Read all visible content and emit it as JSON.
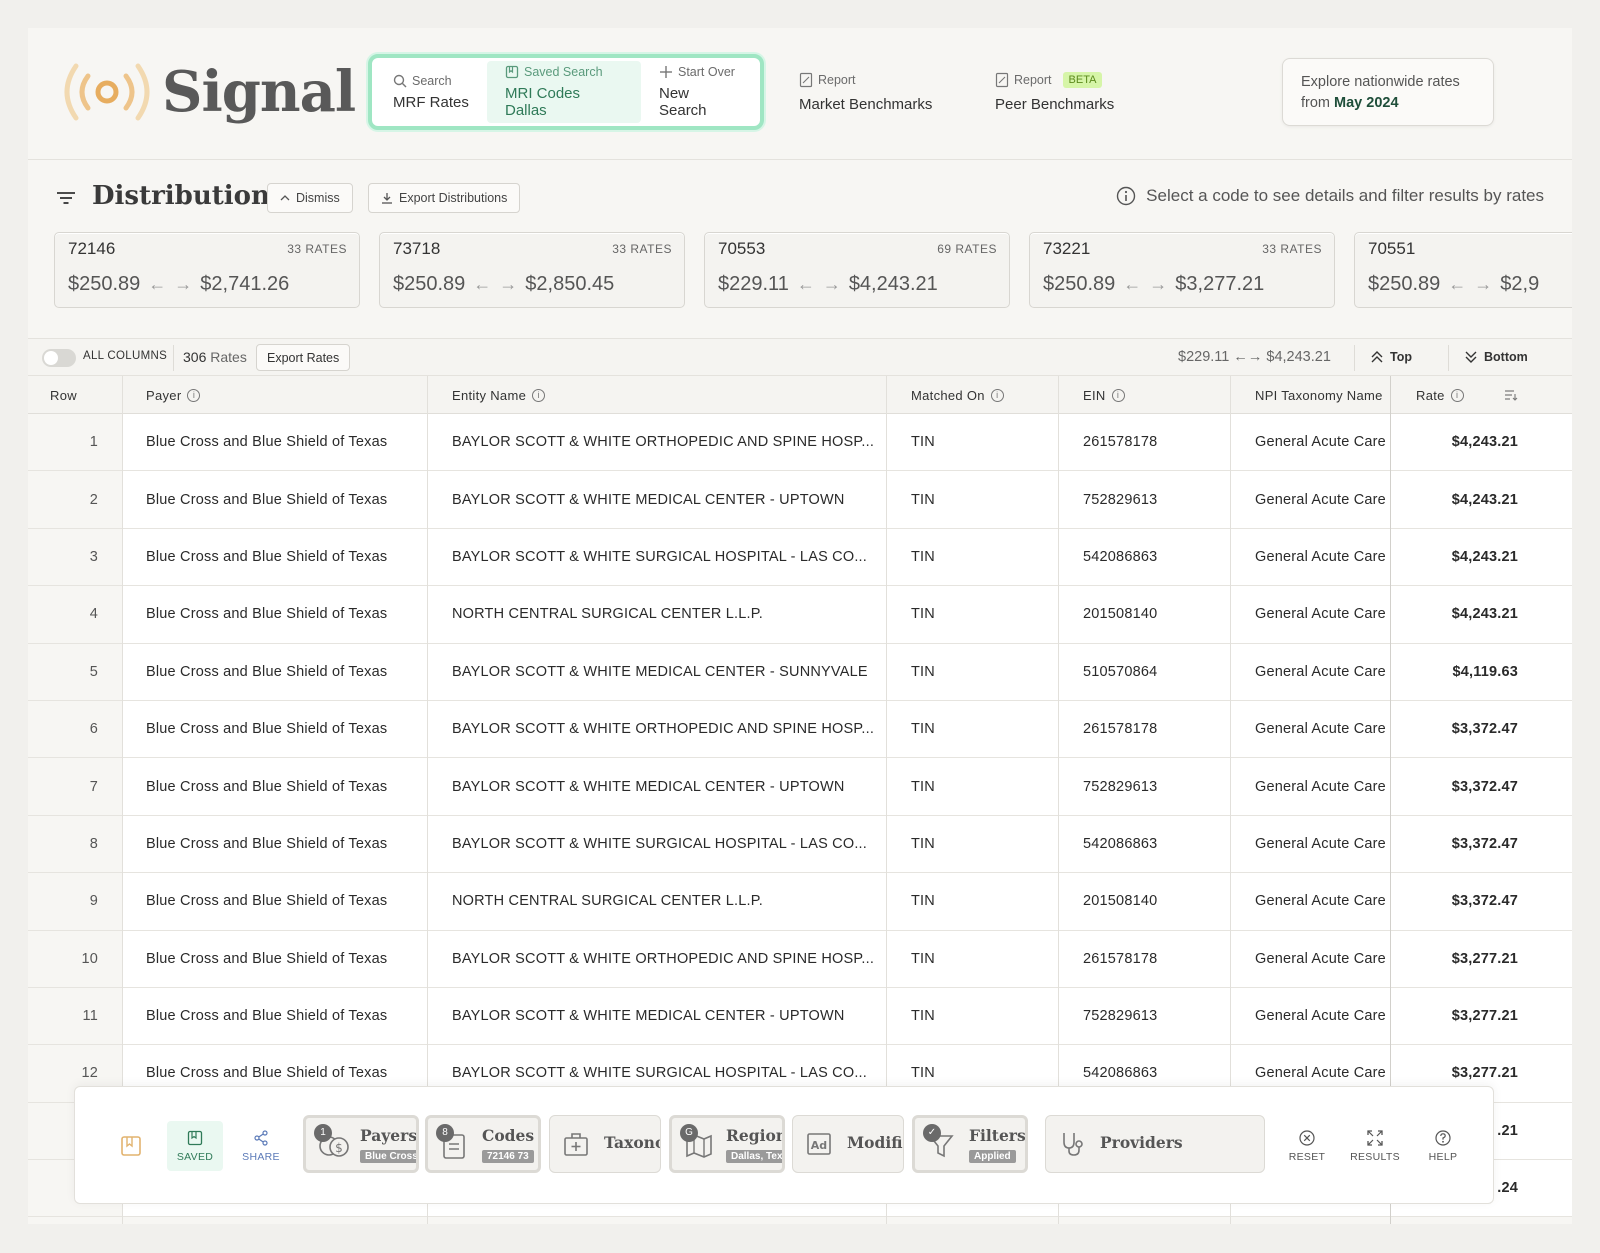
{
  "brand": {
    "name": "Signal"
  },
  "search": {
    "items": [
      {
        "small": "Search",
        "big": "MRF Rates",
        "icon": "search-icon"
      },
      {
        "small": "Saved Search",
        "big": "MRI Codes Dallas",
        "icon": "bookmark-icon"
      },
      {
        "small": "Start Over",
        "big": "New Search",
        "icon": "plus-icon"
      }
    ]
  },
  "reports": [
    {
      "small": "Report",
      "big": "Market Benchmarks"
    },
    {
      "small": "Report",
      "badge": "BETA",
      "big": "Peer Benchmarks"
    }
  ],
  "explore": {
    "line1": "Explore nationwide rates",
    "from": "from",
    "period": "May 2024"
  },
  "distributions": {
    "title": "Distributions",
    "dismiss": "Dismiss",
    "export": "Export Distributions",
    "hint": "Select a code to see details and filter results by rates",
    "cards": [
      {
        "code": "72146",
        "count": "33 RATES",
        "min": "$250.89",
        "max": "$2,741.26"
      },
      {
        "code": "73718",
        "count": "33 RATES",
        "min": "$250.89",
        "max": "$2,850.45"
      },
      {
        "code": "70553",
        "count": "69 RATES",
        "min": "$229.11",
        "max": "$4,243.21"
      },
      {
        "code": "73221",
        "count": "33 RATES",
        "min": "$250.89",
        "max": "$3,277.21"
      },
      {
        "code": "70551",
        "count": "",
        "min": "$250.89",
        "max": "$2,9"
      }
    ]
  },
  "toolbar": {
    "all_columns": "ALL COLUMNS",
    "rates_count": "306",
    "rates_label": "Rates",
    "export_rates": "Export Rates",
    "range": "$229.11 ←→ $4,243.21",
    "top": "Top",
    "bottom": "Bottom"
  },
  "table": {
    "columns": [
      "Row",
      "Payer",
      "Entity Name",
      "Matched On",
      "EIN",
      "NPI Taxonomy Name",
      "Rate"
    ],
    "rows": [
      {
        "row": "1",
        "payer": "Blue Cross and Blue Shield of Texas",
        "entity": "BAYLOR SCOTT & WHITE ORTHOPEDIC AND SPINE HOSP...",
        "matched": "TIN",
        "ein": "261578178",
        "taxonomy": "General Acute Care",
        "rate": "$4,243.21"
      },
      {
        "row": "2",
        "payer": "Blue Cross and Blue Shield of Texas",
        "entity": "BAYLOR SCOTT & WHITE MEDICAL CENTER - UPTOWN",
        "matched": "TIN",
        "ein": "752829613",
        "taxonomy": "General Acute Care",
        "rate": "$4,243.21"
      },
      {
        "row": "3",
        "payer": "Blue Cross and Blue Shield of Texas",
        "entity": "BAYLOR SCOTT & WHITE SURGICAL HOSPITAL - LAS CO...",
        "matched": "TIN",
        "ein": "542086863",
        "taxonomy": "General Acute Care",
        "rate": "$4,243.21"
      },
      {
        "row": "4",
        "payer": "Blue Cross and Blue Shield of Texas",
        "entity": "NORTH CENTRAL SURGICAL CENTER L.L.P.",
        "matched": "TIN",
        "ein": "201508140",
        "taxonomy": "General Acute Care",
        "rate": "$4,243.21"
      },
      {
        "row": "5",
        "payer": "Blue Cross and Blue Shield of Texas",
        "entity": "BAYLOR SCOTT & WHITE MEDICAL CENTER - SUNNYVALE",
        "matched": "TIN",
        "ein": "510570864",
        "taxonomy": "General Acute Care",
        "rate": "$4,119.63"
      },
      {
        "row": "6",
        "payer": "Blue Cross and Blue Shield of Texas",
        "entity": "BAYLOR SCOTT & WHITE ORTHOPEDIC AND SPINE HOSP...",
        "matched": "TIN",
        "ein": "261578178",
        "taxonomy": "General Acute Care",
        "rate": "$3,372.47"
      },
      {
        "row": "7",
        "payer": "Blue Cross and Blue Shield of Texas",
        "entity": "BAYLOR SCOTT & WHITE MEDICAL CENTER - UPTOWN",
        "matched": "TIN",
        "ein": "752829613",
        "taxonomy": "General Acute Care",
        "rate": "$3,372.47"
      },
      {
        "row": "8",
        "payer": "Blue Cross and Blue Shield of Texas",
        "entity": "BAYLOR SCOTT & WHITE SURGICAL HOSPITAL - LAS CO...",
        "matched": "TIN",
        "ein": "542086863",
        "taxonomy": "General Acute Care",
        "rate": "$3,372.47"
      },
      {
        "row": "9",
        "payer": "Blue Cross and Blue Shield of Texas",
        "entity": "NORTH CENTRAL SURGICAL CENTER L.L.P.",
        "matched": "TIN",
        "ein": "201508140",
        "taxonomy": "General Acute Care",
        "rate": "$3,372.47"
      },
      {
        "row": "10",
        "payer": "Blue Cross and Blue Shield of Texas",
        "entity": "BAYLOR SCOTT & WHITE ORTHOPEDIC AND SPINE HOSP...",
        "matched": "TIN",
        "ein": "261578178",
        "taxonomy": "General Acute Care",
        "rate": "$3,277.21"
      },
      {
        "row": "11",
        "payer": "Blue Cross and Blue Shield of Texas",
        "entity": "BAYLOR SCOTT & WHITE MEDICAL CENTER - UPTOWN",
        "matched": "TIN",
        "ein": "752829613",
        "taxonomy": "General Acute Care",
        "rate": "$3,277.21"
      },
      {
        "row": "12",
        "payer": "Blue Cross and Blue Shield of Texas",
        "entity": "BAYLOR SCOTT & WHITE SURGICAL HOSPITAL - LAS CO...",
        "matched": "TIN",
        "ein": "542086863",
        "taxonomy": "General Acute Care",
        "rate": "$3,277.21"
      },
      {
        "row": "",
        "payer": "",
        "entity": "",
        "matched": "",
        "ein": "",
        "taxonomy": "",
        "rate": ".21"
      },
      {
        "row": "",
        "payer": "",
        "entity": "",
        "matched": "",
        "ein": "",
        "taxonomy": "",
        "rate": ".24"
      }
    ]
  },
  "bottombar": {
    "saved": "SAVED",
    "share": "SHARE",
    "chips": [
      {
        "label": "Payers",
        "badge": "1",
        "tag": "Blue Cross",
        "icon": "coins-icon"
      },
      {
        "label": "Codes",
        "badge": "8",
        "tag": "72146  73",
        "icon": "document-icon"
      },
      {
        "label": "Taxonomy",
        "icon": "medical-case-icon"
      },
      {
        "label": "Regions",
        "badge": "G",
        "tag": "Dallas, Tex",
        "icon": "map-icon"
      },
      {
        "label": "Modifier",
        "icon": "ad-icon"
      },
      {
        "label": "Filters",
        "badge": "✓",
        "tag": "Applied",
        "icon": "filter-icon"
      },
      {
        "label": "Providers",
        "icon": "stethoscope-icon"
      }
    ],
    "reset": "RESET",
    "results": "RESULTS",
    "help": "HELP"
  }
}
